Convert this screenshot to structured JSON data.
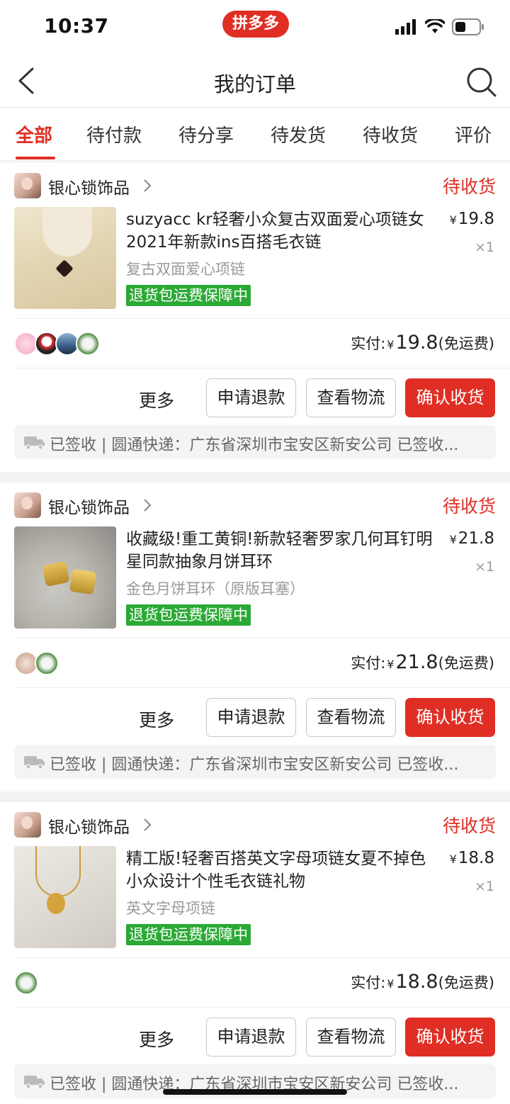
{
  "status_bar": {
    "time": "10:37",
    "brand": "拼多多"
  },
  "nav": {
    "title": "我的订单"
  },
  "tabs": [
    {
      "label": "全部"
    },
    {
      "label": "待付款"
    },
    {
      "label": "待分享"
    },
    {
      "label": "待发货"
    },
    {
      "label": "待收货"
    },
    {
      "label": "评价"
    }
  ],
  "orders": [
    {
      "shop_name": "银心锁饰品",
      "status": "待收货",
      "title": "suzyacc kr轻奢小众复古双面爱心项链女 2021年新款ins百搭毛衣链",
      "currency": "¥",
      "price": "19.8",
      "qty": "×1",
      "spec": "复古双面爱心项链",
      "guarantee": "退货包运费保障中",
      "paid_label": "实付:",
      "paid_amount": "19.8",
      "shipping": "(免运费)",
      "more": "更多",
      "refund": "申请退款",
      "track": "查看物流",
      "confirm": "确认收货",
      "logistics": "已签收 | 圆通快递：广东省深圳市宝安区新安公司 已签收..."
    },
    {
      "shop_name": "银心锁饰品",
      "status": "待收货",
      "title": "收藏级!重工黄铜!新款轻奢罗家几何耳钉明星同款抽象月饼耳环",
      "currency": "¥",
      "price": "21.8",
      "qty": "×1",
      "spec": "金色月饼耳环（原版耳塞）",
      "guarantee": "退货包运费保障中",
      "paid_label": "实付:",
      "paid_amount": "21.8",
      "shipping": "(免运费)",
      "more": "更多",
      "refund": "申请退款",
      "track": "查看物流",
      "confirm": "确认收货",
      "logistics": "已签收 | 圆通快递：广东省深圳市宝安区新安公司 已签收..."
    },
    {
      "shop_name": "银心锁饰品",
      "status": "待收货",
      "title": "精工版!轻奢百搭英文字母项链女夏不掉色小众设计个性毛衣链礼物",
      "currency": "¥",
      "price": "18.8",
      "qty": "×1",
      "spec": "英文字母项链",
      "guarantee": "退货包运费保障中",
      "paid_label": "实付:",
      "paid_amount": "18.8",
      "shipping": "(免运费)",
      "more": "更多",
      "refund": "申请退款",
      "track": "查看物流",
      "confirm": "确认收货",
      "logistics": "已签收 | 圆通快递：广东省深圳市宝安区新安公司 已签收..."
    }
  ],
  "colors": {
    "accent": "#e02e24",
    "guarantee_green": "#2ba935"
  }
}
